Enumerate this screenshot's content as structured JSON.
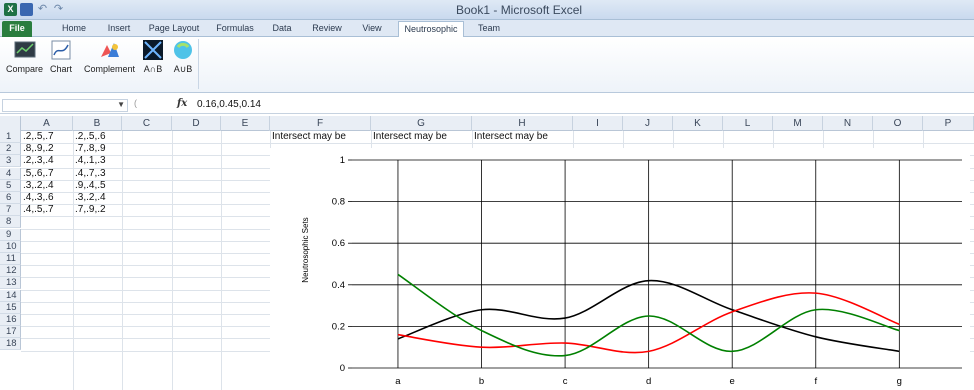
{
  "window": {
    "title": "Book1 - Microsoft Excel",
    "app_icon": "X"
  },
  "tabs": [
    {
      "label": "File",
      "x": 0
    },
    {
      "label": "Home"
    },
    {
      "label": "Insert"
    },
    {
      "label": "Page Layout"
    },
    {
      "label": "Formulas"
    },
    {
      "label": "Data"
    },
    {
      "label": "Review"
    },
    {
      "label": "View"
    },
    {
      "label": "Neutrosophic",
      "active": true
    },
    {
      "label": "Team"
    }
  ],
  "ribbon": {
    "buttons": [
      {
        "label": "Compare",
        "icon": "compare-icon"
      },
      {
        "label": "Chart",
        "icon": "chart-icon"
      },
      {
        "label": "Complement",
        "icon": "complement-icon"
      },
      {
        "label": "A∩B",
        "icon": "intersection-icon"
      },
      {
        "label": "A∪B",
        "icon": "union-icon"
      }
    ]
  },
  "formula_bar": {
    "name_box": "",
    "fx": "fx",
    "value": "0.16,0.45,0.14"
  },
  "columns": [
    "A",
    "B",
    "C",
    "D",
    "E",
    "F",
    "G",
    "H",
    "I",
    "J",
    "K",
    "L",
    "M",
    "N",
    "O",
    "P"
  ],
  "rows": [
    "1",
    "2",
    "3",
    "4",
    "5",
    "6",
    "7",
    "8",
    "9",
    "10",
    "11",
    "12",
    "13",
    "14",
    "15",
    "16",
    "17",
    "18"
  ],
  "cells": {
    "A": [
      ".2,.5,.7",
      ".8,.9,.2",
      ".2,.3,.4",
      ".5,.6,.7",
      ".3,.2,.4",
      ".4,.3,.6",
      ".4,.5,.7"
    ],
    "B": [
      ".2,.5,.6",
      ".7,.8,.9",
      ".4,.1,.3",
      ".4,.7,.3",
      ".9,.4,.5",
      ".3,.2,.4",
      ".7,.9,.2"
    ],
    "F1": "Intersect may be",
    "G1": "Intersect may be",
    "H1": "Intersect may be"
  },
  "chart_data": {
    "type": "line",
    "title": "",
    "xlabel": "",
    "ylabel": "Neutrosophic Sets",
    "categories": [
      "a",
      "b",
      "c",
      "d",
      "e",
      "f",
      "g"
    ],
    "ylim": [
      0,
      1
    ],
    "yticks": [
      "0",
      "0.2",
      "0.4",
      "0.6",
      "0.8",
      "1"
    ],
    "grid": true,
    "series": [
      {
        "color": "#000000",
        "values": [
          0.14,
          0.28,
          0.24,
          0.42,
          0.28,
          0.15,
          0.08
        ]
      },
      {
        "color": "#ff0000",
        "values": [
          0.16,
          0.1,
          0.12,
          0.08,
          0.27,
          0.36,
          0.21
        ]
      },
      {
        "color": "#008000",
        "values": [
          0.45,
          0.18,
          0.06,
          0.25,
          0.08,
          0.28,
          0.18
        ]
      }
    ]
  }
}
